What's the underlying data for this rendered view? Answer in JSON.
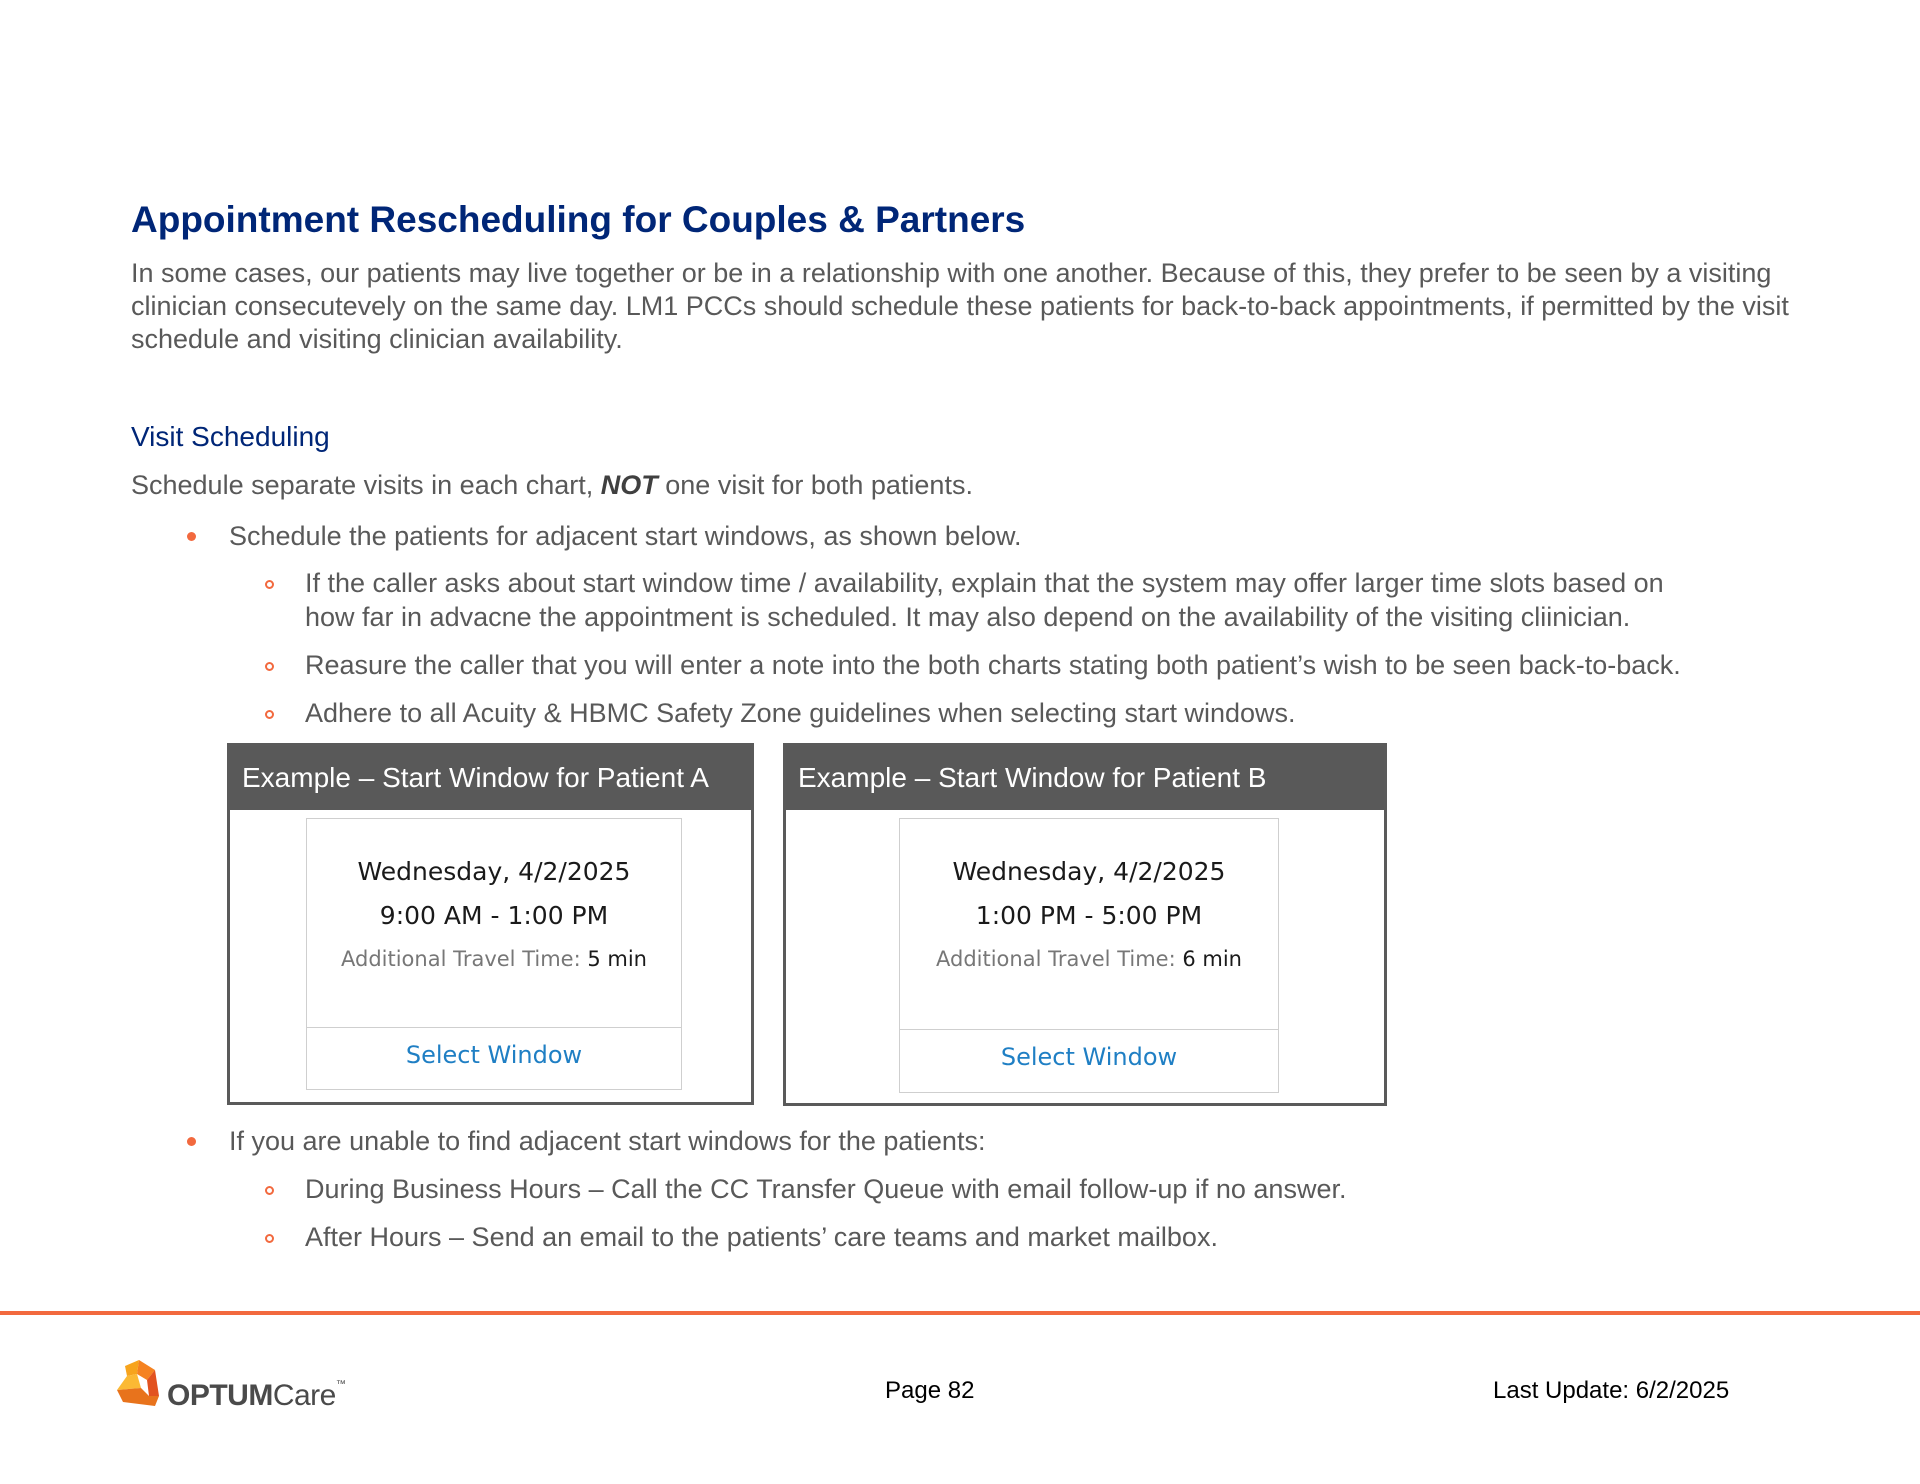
{
  "title": "Appointment Rescheduling for Couples & Partners",
  "intro": "In some cases, our patients may live together or be in a relationship with one another. Because of this, they prefer to be seen by a visiting clinician consecutevely on the same day. LM1 PCCs should schedule these patients for back-to-back appointments, if permitted by the visit schedule and visiting clinician availability.",
  "section_heading": "Visit Scheduling",
  "lead": {
    "before": "Schedule separate visits in each chart, ",
    "emphasis": "NOT",
    "after": " one visit for both patients."
  },
  "bullets": [
    {
      "text": "Schedule the patients for adjacent start windows, as shown below.",
      "subitems": [
        {
          "line1": "If the caller asks about start window time / availability, explain that the system may offer larger time slots based on",
          "line2": "how far in advacne the appointment is scheduled. It may also depend on the availability of the visiting cliinician."
        },
        {
          "line1": "Reasure the caller that you will enter a note into the both charts stating both patient’s wish to be seen back-to-back."
        },
        {
          "line1": "Adhere to all Acuity & HBMC Safety Zone guidelines when selecting start windows."
        }
      ]
    },
    {
      "text": "If you are unable to find adjacent start windows for the patients:",
      "subitems": [
        {
          "line1": "During Business Hours – Call the CC Transfer Queue with email follow-up if no answer."
        },
        {
          "line1": "After Hours – Send an email to the patients’ care teams and market mailbox."
        }
      ]
    }
  ],
  "examples": [
    {
      "header": "Example – Start Window for Patient A",
      "date": "Wednesday, 4/2/2025",
      "time": "9:00 AM - 1:00 PM",
      "travel_label": "Additional Travel Time:",
      "travel_value": "5 min",
      "action": "Select Window"
    },
    {
      "header": "Example – Start Window for Patient B",
      "date": "Wednesday, 4/2/2025",
      "time": "1:00 PM - 5:00 PM",
      "travel_label": "Additional Travel Time:",
      "travel_value": "6 min",
      "action": "Select Window"
    }
  ],
  "footer": {
    "logo_brand": "OPTUM",
    "logo_suffix": "Care",
    "logo_tm": "™",
    "page": "Page 82",
    "last_update": "Last Update: 6/2/2025"
  },
  "colors": {
    "heading": "#002677",
    "accent": "#f2693e",
    "body_text": "#595959",
    "card_header": "#595959",
    "link": "#1f7fc4"
  }
}
